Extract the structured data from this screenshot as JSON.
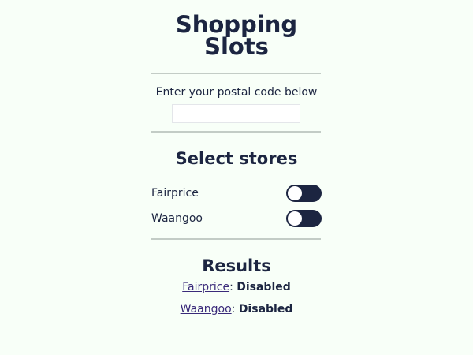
{
  "header": {
    "title_line1": "Shopping",
    "title_line2": "Slots"
  },
  "postal": {
    "label": "Enter your postal code below",
    "value": "",
    "placeholder": ""
  },
  "stores": {
    "heading": "Select stores",
    "items": [
      {
        "name": "Fairprice",
        "enabled": false,
        "toggle_icon": "toggle-off-icon"
      },
      {
        "name": "Waangoo",
        "enabled": false,
        "toggle_icon": "toggle-off-icon"
      }
    ]
  },
  "results": {
    "heading": "Results",
    "separator": ": ",
    "items": [
      {
        "store": "Fairprice",
        "status": "Disabled"
      },
      {
        "store": "Waangoo",
        "status": "Disabled"
      }
    ]
  },
  "colors": {
    "background": "#f8fff8",
    "text": "#1c2541",
    "toggle_track": "#1c2541",
    "divider": "#c3ccc6",
    "link": "#3a2a7a"
  }
}
